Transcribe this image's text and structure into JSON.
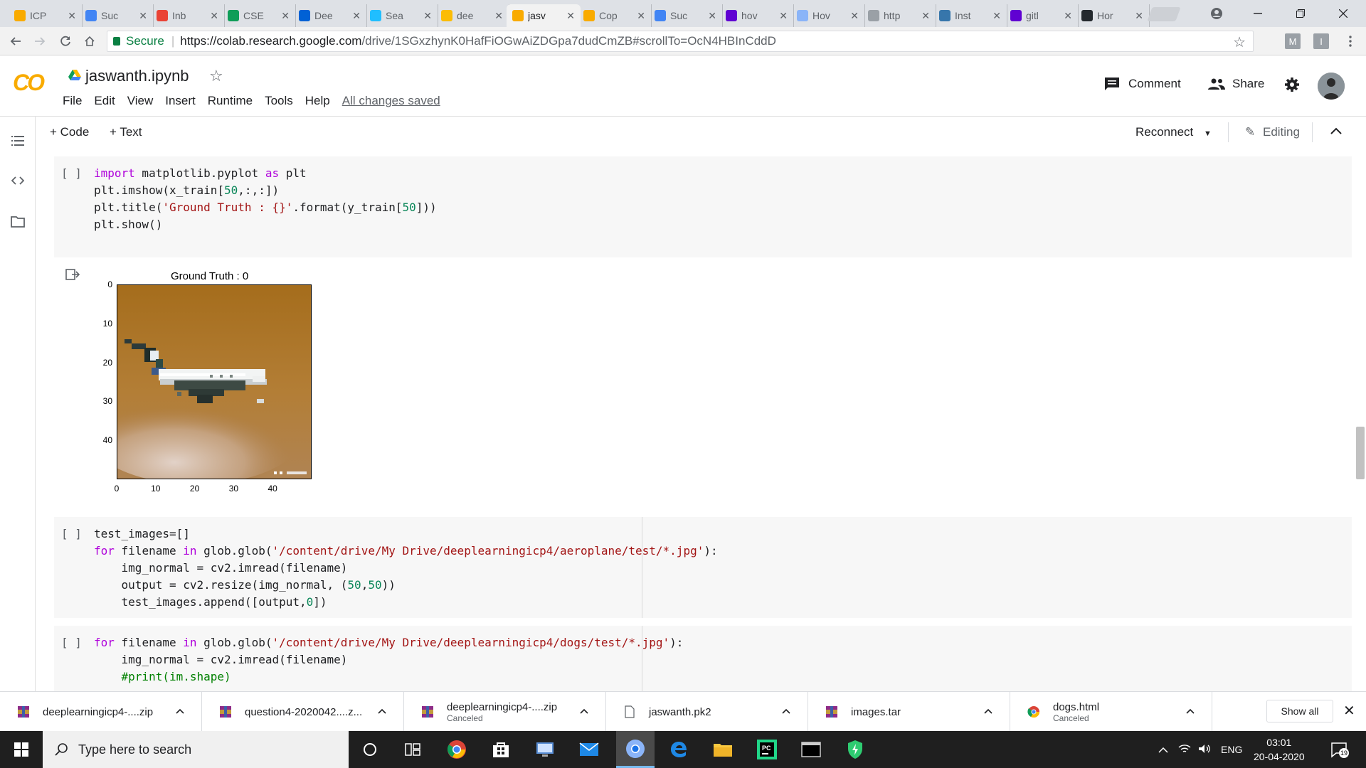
{
  "browser": {
    "tabs": [
      {
        "label": "ICP",
        "icon": "colab-icon",
        "color": "#f9ab00"
      },
      {
        "label": "Suc",
        "icon": "google-icon",
        "color": "#4285f4"
      },
      {
        "label": "Inb",
        "icon": "gmail-icon",
        "color": "#ea4335"
      },
      {
        "label": "CSE",
        "icon": "sheets-icon",
        "color": "#0f9d58"
      },
      {
        "label": "Dee",
        "icon": "box-icon",
        "color": "#0061d5"
      },
      {
        "label": "Sea",
        "icon": "kaggle-icon",
        "color": "#20beff"
      },
      {
        "label": "dee",
        "icon": "drive-icon",
        "color": "#fbbc04"
      },
      {
        "label": "jasv",
        "icon": "colab-icon",
        "color": "#f9ab00",
        "active": true
      },
      {
        "label": "Cop",
        "icon": "colab-icon",
        "color": "#f9ab00"
      },
      {
        "label": "Suc",
        "icon": "google-icon",
        "color": "#4285f4"
      },
      {
        "label": "hov",
        "icon": "yahoo-icon",
        "color": "#6001d2"
      },
      {
        "label": "Hov",
        "icon": "cloud-icon",
        "color": "#8ab4f8"
      },
      {
        "label": "http",
        "icon": "page-icon",
        "color": "#9aa0a6"
      },
      {
        "label": "Inst",
        "icon": "python-icon",
        "color": "#3776ab"
      },
      {
        "label": "gitl",
        "icon": "yahoo-icon",
        "color": "#6001d2"
      },
      {
        "label": "Hor",
        "icon": "github-icon",
        "color": "#24292e"
      }
    ],
    "close_glyph": "✕",
    "secure_label": "Secure",
    "url_host": "https://colab.research.google.com",
    "url_path": "/drive/1SGxzhynK0HafFiOGwAiZDGpa7dudCmZB#scrollTo=OcN4HBInCddD",
    "ext1": "M",
    "ext2": "I"
  },
  "colab": {
    "logo": "CO",
    "notebook_title": "jaswanth.ipynb",
    "menu": [
      "File",
      "Edit",
      "View",
      "Insert",
      "Runtime",
      "Tools",
      "Help"
    ],
    "save_status": "All changes saved",
    "comment_label": "Comment",
    "share_label": "Share",
    "add_code_label": "+ Code",
    "add_text_label": "+ Text",
    "reconnect_label": "Reconnect",
    "editing_label": "Editing"
  },
  "cells": [
    {
      "run_label": "[ ]",
      "lines": [
        [
          {
            "t": "import",
            "c": "kw"
          },
          {
            "t": " matplotlib.pyplot "
          },
          {
            "t": "as",
            "c": "kw"
          },
          {
            "t": " plt"
          }
        ],
        [
          {
            "t": "plt.imshow(x_train["
          },
          {
            "t": "50",
            "c": "num"
          },
          {
            "t": ",:,:])"
          }
        ],
        [
          {
            "t": "plt.title("
          },
          {
            "t": "'Ground Truth : {}'",
            "c": "str"
          },
          {
            "t": ".format(y_train["
          },
          {
            "t": "50",
            "c": "num"
          },
          {
            "t": "]))"
          }
        ],
        [
          {
            "t": "plt.show()"
          }
        ]
      ]
    },
    {
      "run_label": "[ ]",
      "lines": [
        [
          {
            "t": "test_images=[]"
          }
        ],
        [
          {
            "t": "for",
            "c": "kw"
          },
          {
            "t": " filename "
          },
          {
            "t": "in",
            "c": "kw"
          },
          {
            "t": " glob.glob("
          },
          {
            "t": "'/content/drive/My Drive/deeplearningicp4/aeroplane/test/*.jpg'",
            "c": "str"
          },
          {
            "t": "):"
          }
        ],
        [
          {
            "t": "    img_normal = cv2.imread(filename)"
          }
        ],
        [
          {
            "t": "    output = cv2.resize(img_normal, ("
          },
          {
            "t": "50",
            "c": "num"
          },
          {
            "t": ","
          },
          {
            "t": "50",
            "c": "num"
          },
          {
            "t": "))"
          }
        ],
        [
          {
            "t": "    test_images.append([output,"
          },
          {
            "t": "0",
            "c": "num"
          },
          {
            "t": "])"
          }
        ]
      ]
    },
    {
      "run_label": "[ ]",
      "lines": [
        [
          {
            "t": "for",
            "c": "kw"
          },
          {
            "t": " filename "
          },
          {
            "t": "in",
            "c": "kw"
          },
          {
            "t": " glob.glob("
          },
          {
            "t": "'/content/drive/My Drive/deeplearningicp4/dogs/test/*.jpg'",
            "c": "str"
          },
          {
            "t": "):"
          }
        ],
        [
          {
            "t": "    img_normal = cv2.imread(filename)"
          }
        ],
        [
          {
            "t": "    #print(im.shape)",
            "c": "cm"
          }
        ]
      ]
    }
  ],
  "output": {
    "title": "Ground Truth : 0",
    "yticks": [
      "0",
      "10",
      "20",
      "30",
      "40"
    ],
    "xticks": [
      "0",
      "10",
      "20",
      "30",
      "40"
    ]
  },
  "downloads": {
    "items": [
      {
        "name": "deeplearningicp4-....zip",
        "sub": "",
        "icon": "archive-icon"
      },
      {
        "name": "question4-2020042....z...",
        "sub": "",
        "icon": "archive-icon"
      },
      {
        "name": "deeplearningicp4-....zip",
        "sub": "Canceled",
        "icon": "archive-icon"
      },
      {
        "name": "jaswanth.pk2",
        "sub": "",
        "icon": "file-icon"
      },
      {
        "name": "images.tar",
        "sub": "",
        "icon": "archive-icon"
      },
      {
        "name": "dogs.html",
        "sub": "Canceled",
        "icon": "chrome-icon"
      }
    ],
    "show_all_label": "Show all"
  },
  "taskbar": {
    "search_placeholder": "Type here to search",
    "language": "ENG",
    "time": "03:01",
    "date": "20-04-2020",
    "notification_count": "19"
  }
}
